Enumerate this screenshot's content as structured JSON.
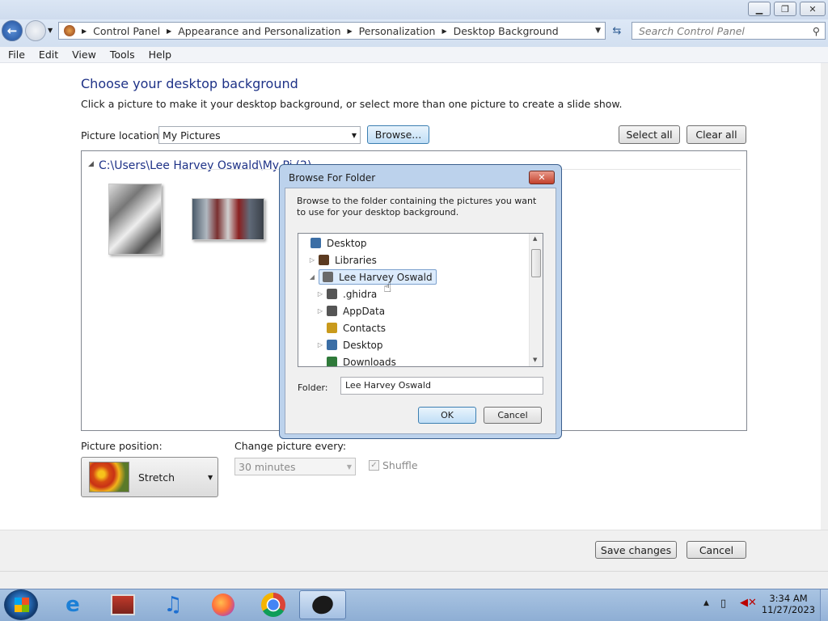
{
  "window": {
    "minimize_icon": "minimize-icon",
    "maximize_icon": "restore-icon",
    "close_icon": "close-icon"
  },
  "address": {
    "breadcrumbs": [
      "Control Panel",
      "Appearance and Personalization",
      "Personalization",
      "Desktop Background"
    ],
    "search_placeholder": "Search Control Panel"
  },
  "menu": [
    "File",
    "Edit",
    "View",
    "Tools",
    "Help"
  ],
  "main": {
    "title": "Choose your desktop background",
    "description": "Click a picture to make it your desktop background, or select more than one picture to create a slide show.",
    "picture_location_label": "Picture location:",
    "picture_location_value": "My Pictures",
    "browse_label": "Browse...",
    "select_all_label": "Select all",
    "clear_all_label": "Clear all",
    "folder_path": "C:\\Users\\Lee Harvey Oswald\\My Pi",
    "folder_path_suffix": "(2)",
    "picture_position_label": "Picture position:",
    "picture_position_value": "Stretch",
    "change_every_label": "Change picture every:",
    "change_every_value": "30 minutes",
    "shuffle_label": "Shuffle",
    "save_label": "Save changes",
    "cancel_label": "Cancel"
  },
  "dialog": {
    "title": "Browse For Folder",
    "instruction": "Browse to the folder containing the pictures you want to use for your desktop background.",
    "tree": [
      {
        "label": "Desktop",
        "level": 0,
        "expander": "",
        "selected": false,
        "color": "#3b6ea5"
      },
      {
        "label": "Libraries",
        "level": 1,
        "expander": "▷",
        "selected": false,
        "color": "#5b3a20"
      },
      {
        "label": "Lee Harvey Oswald",
        "level": 1,
        "expander": "◢",
        "selected": true,
        "color": "#6a6a6a"
      },
      {
        "label": ".ghidra",
        "level": 2,
        "expander": "▷",
        "selected": false,
        "color": "#555"
      },
      {
        "label": "AppData",
        "level": 2,
        "expander": "▷",
        "selected": false,
        "color": "#555"
      },
      {
        "label": "Contacts",
        "level": 2,
        "expander": "",
        "selected": false,
        "color": "#c99a1c"
      },
      {
        "label": "Desktop",
        "level": 2,
        "expander": "▷",
        "selected": false,
        "color": "#3b6ea5"
      },
      {
        "label": "Downloads",
        "level": 2,
        "expander": "",
        "selected": false,
        "color": "#2f7a3a"
      }
    ],
    "folder_label": "Folder:",
    "folder_value": "Lee Harvey Oswald",
    "ok_label": "OK",
    "cancel_label": "Cancel"
  },
  "taskbar": {
    "apps": [
      "internet-explorer-icon",
      "media-center-icon",
      "itunes-icon",
      "firefox-icon",
      "chrome-icon",
      "paint-app-icon"
    ],
    "time": "3:34 AM",
    "date": "11/27/2023"
  }
}
